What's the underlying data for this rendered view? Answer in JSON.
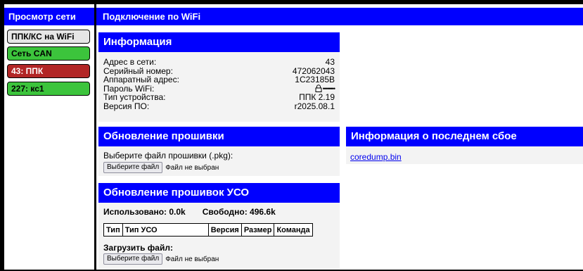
{
  "sidebar": {
    "header": "Просмотр сети",
    "items": [
      {
        "label": "ППК/КС на WiFi",
        "color": "#e6e6e6"
      },
      {
        "label": "Сеть CAN",
        "color": "#3cc43c"
      },
      {
        "label": "43: ППК",
        "color": "#b22626"
      },
      {
        "label": "227: кс1",
        "color": "#3cc43c"
      }
    ]
  },
  "header": {
    "title": "Подключение по WiFi"
  },
  "info_panel": {
    "title": "Информация",
    "rows": [
      {
        "label": "Адрес в сети:",
        "value": "43"
      },
      {
        "label": "Серийный номер:",
        "value": "472062043"
      },
      {
        "label": "Аппаратный адрес:",
        "value": "1C23185B"
      },
      {
        "label": "Пароль WiFi:",
        "value": "••••••••",
        "icon": "lock-icon"
      },
      {
        "label": "Тип устройства:",
        "value": "ППК 2.19"
      },
      {
        "label": "Версия ПО:",
        "value": "r2025.08.1"
      }
    ]
  },
  "firmware_panel": {
    "title": "Обновление прошивки",
    "prompt": "Выберите файл прошивки (.pkg):",
    "button_label": "Выберите файл",
    "file_status": "Файл не выбран"
  },
  "uso_panel": {
    "title": "Обновление прошивок УСО",
    "used_label": "Использовано: 0.0k",
    "free_label": "Свободно: 496.6k",
    "table_headers": [
      "Тип",
      "Тип УСО",
      "Версия",
      "Размер",
      "Команда"
    ],
    "upload_label": "Загрузить файл:",
    "button_label": "Выберите файл",
    "file_status": "Файл не выбран"
  },
  "crash_panel": {
    "title": "Информация о последнем сбое",
    "link_text": "coredump.bin"
  },
  "colors": {
    "accent": "#0000ff",
    "panel_bg": "#f3f3f3"
  }
}
